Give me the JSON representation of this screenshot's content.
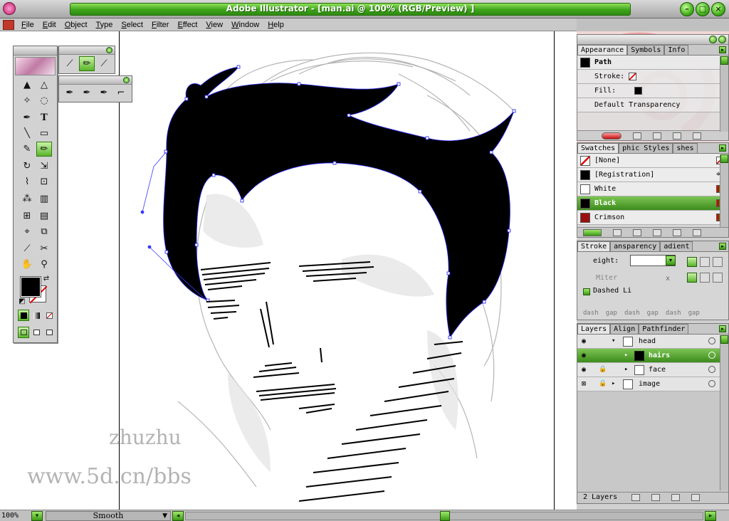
{
  "app": {
    "title": "Adobe Illustrator - [man.ai @ 100% (RGB/Preview) ]",
    "accent": "#3da41a"
  },
  "menu": [
    "File",
    "Edit",
    "Object",
    "Type",
    "Select",
    "Filter",
    "Effect",
    "View",
    "Window",
    "Help"
  ],
  "appearance": {
    "tabs": [
      "Appearance",
      "Symbols",
      "Info"
    ],
    "item": "Path",
    "stroke_label": "Stroke:",
    "fill_label": "Fill:",
    "transparency": "Default Transparency"
  },
  "swatches": {
    "tabs": [
      "Swatches",
      "phic Styles",
      "shes"
    ],
    "items": [
      {
        "name": "[None]",
        "color": "#ffffff"
      },
      {
        "name": "[Registration]",
        "color": "#000000"
      },
      {
        "name": "White",
        "color": "#ffffff"
      },
      {
        "name": "Black",
        "color": "#000000"
      },
      {
        "name": "Crimson",
        "color": "#9a1010"
      }
    ],
    "selected": "Black"
  },
  "stroke": {
    "tabs": [
      "Stroke",
      "ansparency",
      "adient"
    ],
    "weight_label": "eight:",
    "miter_label": "Miter",
    "miter_unit": "x",
    "dashed_label": "Dashed Li",
    "dash_labels": [
      "dash",
      "gap",
      "dash",
      "gap",
      "dash",
      "gap"
    ]
  },
  "layers": {
    "tabs": [
      "Layers",
      "Align",
      "Pathfinder"
    ],
    "rows": [
      {
        "name": "head",
        "level": 0,
        "expanded": true
      },
      {
        "name": "hairs",
        "level": 1,
        "selected": true
      },
      {
        "name": "face",
        "level": 1
      },
      {
        "name": "image",
        "level": 0
      }
    ],
    "count": "2 Layers"
  },
  "status": {
    "zoom": "100%",
    "mode": "Smooth"
  },
  "watermark": {
    "line1": "zhuzhu",
    "line2": "www.5d.cn/bbs"
  }
}
